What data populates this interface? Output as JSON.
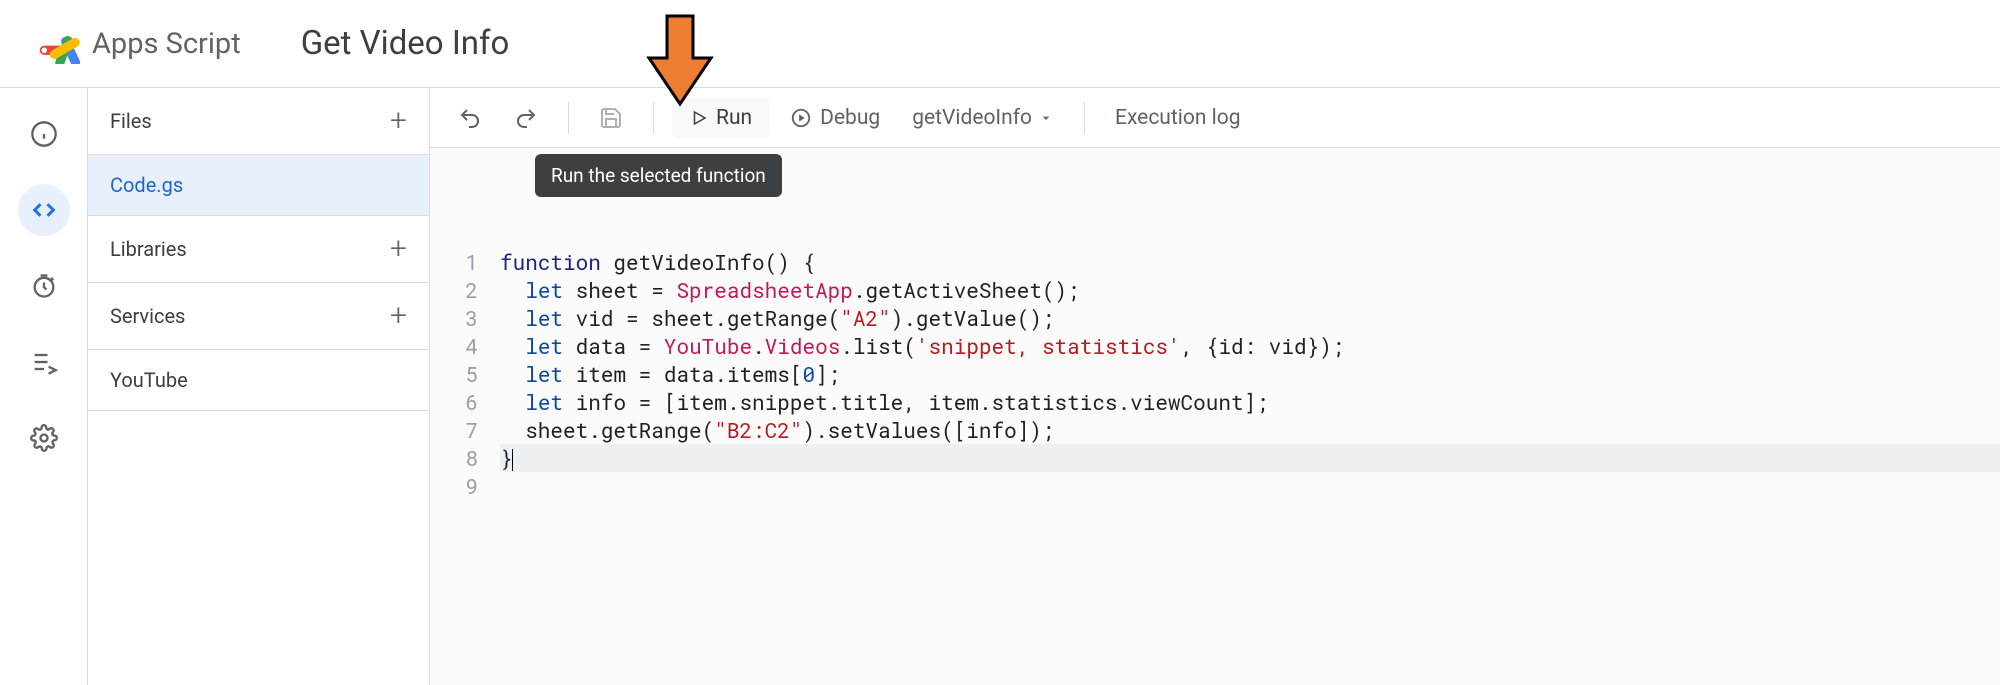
{
  "header": {
    "brand": "Apps Script",
    "project_title": "Get Video Info"
  },
  "rail": {
    "items": [
      "info",
      "editor",
      "triggers",
      "executions",
      "settings"
    ],
    "active_index": 1
  },
  "side": {
    "files_label": "Files",
    "files": [
      "Code.gs"
    ],
    "selected_file_index": 0,
    "libraries_label": "Libraries",
    "services_label": "Services",
    "services": [
      "YouTube"
    ]
  },
  "toolbar": {
    "undo_tip": "Undo",
    "redo_tip": "Redo",
    "save_tip": "Save",
    "run_label": "Run",
    "debug_label": "Debug",
    "function_selected": "getVideoInfo",
    "execution_log_label": "Execution log"
  },
  "tooltip_text": "Run the selected function",
  "code": {
    "line_count": 9,
    "lines": [
      {
        "n": 1,
        "tokens": [
          [
            "kw",
            "function"
          ],
          [
            "",
            " getVideoInfo() {"
          ]
        ]
      },
      {
        "n": 2,
        "tokens": [
          [
            "",
            "  "
          ],
          [
            "kw2",
            "let"
          ],
          [
            "",
            " sheet = "
          ],
          [
            "obj",
            "SpreadsheetApp"
          ],
          [
            "",
            ".getActiveSheet();"
          ]
        ]
      },
      {
        "n": 3,
        "tokens": [
          [
            "",
            "  "
          ],
          [
            "kw2",
            "let"
          ],
          [
            "",
            " vid = sheet.getRange("
          ],
          [
            "str",
            "\"A2\""
          ],
          [
            "",
            ").getValue();"
          ]
        ]
      },
      {
        "n": 4,
        "tokens": [
          [
            "",
            "  "
          ],
          [
            "kw2",
            "let"
          ],
          [
            "",
            " data = "
          ],
          [
            "obj",
            "YouTube"
          ],
          [
            "",
            "."
          ],
          [
            "obj",
            "Videos"
          ],
          [
            "",
            ".list("
          ],
          [
            "str2",
            "'snippet, statistics'"
          ],
          [
            "",
            ", {id: vid});"
          ]
        ]
      },
      {
        "n": 5,
        "tokens": [
          [
            "",
            "  "
          ],
          [
            "kw2",
            "let"
          ],
          [
            "",
            " item = data.items["
          ],
          [
            "num",
            "0"
          ],
          [
            "",
            "];"
          ]
        ]
      },
      {
        "n": 6,
        "tokens": [
          [
            "",
            "  "
          ],
          [
            "kw2",
            "let"
          ],
          [
            "",
            " info = [item.snippet.title, item.statistics.viewCount];"
          ]
        ]
      },
      {
        "n": 7,
        "tokens": [
          [
            "",
            "  sheet.getRange("
          ],
          [
            "str",
            "\"B2:C2\""
          ],
          [
            "",
            ").setValues([info]);"
          ]
        ]
      },
      {
        "n": 8,
        "tokens": [
          [
            "",
            "}"
          ]
        ],
        "caret": true
      },
      {
        "n": 9,
        "tokens": [
          [
            "",
            ""
          ]
        ]
      }
    ]
  }
}
